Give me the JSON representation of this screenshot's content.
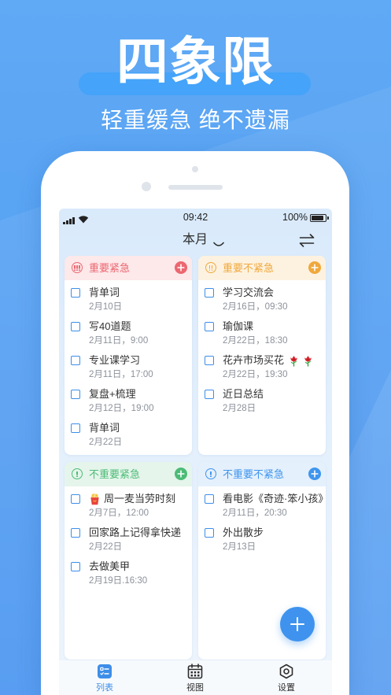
{
  "promo": {
    "title": "四象限",
    "subtitle": "轻重缓急 绝不遗漏"
  },
  "status_bar": {
    "time": "09:42",
    "battery": "100%",
    "battery_level": 1,
    "signal_icon": "signal-bars-icon",
    "wifi_icon": "wifi-icon",
    "battery_icon": "battery-icon"
  },
  "header": {
    "period": "本月",
    "dropdown_icon": "chevron-down-icon",
    "switch_icon": "swap-arrows-icon"
  },
  "quadrants": [
    {
      "title": "重要紧急",
      "accent": "#ec6770",
      "tint": "#fde8ea",
      "icon": "exclamation-circle-icon",
      "marks": 3,
      "add_icon": "plus-circle-icon",
      "tasks": [
        {
          "title": "背单词",
          "date": "2月10日"
        },
        {
          "title": "写40道题",
          "date": "2月11日，9:00"
        },
        {
          "title": "专业课学习",
          "date": "2月11日，17:00"
        },
        {
          "title": "复盘+梳理",
          "date": "2月12日，19:00"
        },
        {
          "title": "背单词",
          "date": "2月22日"
        }
      ]
    },
    {
      "title": "重要不紧急",
      "accent": "#f0a83c",
      "tint": "#fdf2e0",
      "icon": "exclamation-circle-icon",
      "marks": 2,
      "add_icon": "plus-circle-icon",
      "tasks": [
        {
          "title": "学习交流会",
          "date": "2月16日，09:30"
        },
        {
          "title": "瑜伽课",
          "date": "2月22日，18:30"
        },
        {
          "title": "花卉市场买花",
          "date": "2月22日，19:30",
          "emoji_after": [
            "rose-icon",
            "rose-icon"
          ]
        },
        {
          "title": "近日总结",
          "date": "2月28日"
        }
      ]
    },
    {
      "title": "不重要紧急",
      "accent": "#4dbb77",
      "tint": "#e5f5eb",
      "icon": "exclamation-circle-icon",
      "marks": 1,
      "add_icon": "plus-circle-icon",
      "tasks": [
        {
          "title": "周一麦当劳时刻",
          "date": "2月7日，12:00",
          "emoji_before": [
            "fries-icon"
          ]
        },
        {
          "title": "回家路上记得拿快递",
          "date": "2月22日"
        },
        {
          "title": "去做美甲",
          "date": "2月19日.16:30"
        }
      ]
    },
    {
      "title": "不重要不紧急",
      "accent": "#3f95ee",
      "tint": "#e4f0fc",
      "icon": "exclamation-circle-icon",
      "marks": 1,
      "add_icon": "plus-circle-icon",
      "tasks": [
        {
          "title": "看电影《奇迹·笨小孩》",
          "date": "2月11日，20:30"
        },
        {
          "title": "外出散步",
          "date": "2月13日"
        }
      ]
    }
  ],
  "fab": {
    "icon": "plus-icon",
    "color": "#3f93ee"
  },
  "tabs": [
    {
      "label": "列表",
      "icon": "list-icon",
      "active": true
    },
    {
      "label": "视图",
      "icon": "calendar-icon",
      "active": false
    },
    {
      "label": "设置",
      "icon": "settings-icon",
      "active": false
    }
  ],
  "colors": {
    "background_top": "#5fa9f5",
    "background_bottom": "#4c96f0",
    "highlight": "#45a3f9",
    "checkbox": "#3d8ee8",
    "active_tab": "#3d8ee8",
    "text": "#333333",
    "muted": "#8c919a"
  }
}
